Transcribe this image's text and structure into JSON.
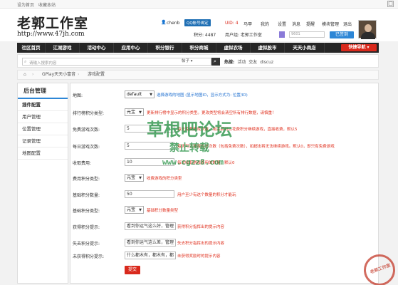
{
  "topbar": {
    "set_home": "设为首页",
    "bookmark": "收藏本站",
    "close_glyph": "□"
  },
  "header": {
    "logo_cn": "老郭工作室",
    "logo_url": "http://www.47jh.com",
    "username": "chenb",
    "qq_bind": "QQ帐号绑定",
    "uid": "UID: 4",
    "menu_links": [
      "马甲",
      "我的",
      "设置",
      "消息",
      "提醒",
      "模块管理",
      "退出"
    ],
    "points": "积分: 4487",
    "user_group": "用户组: 老郭工作室",
    "level_badge": "",
    "signin_input": "9601",
    "signin_button": "已签到"
  },
  "nav": {
    "items": [
      "社区首页",
      "江湖游戏",
      "活动中心",
      "应用中心",
      "积分银行",
      "积分商城",
      "虚拟农场",
      "虚拟股市",
      "天天小商店"
    ],
    "quick_nav": "快捷导航"
  },
  "search": {
    "placeholder": "请输入搜索内容",
    "type": "帖子",
    "hot_label": "热搜:",
    "hot_terms": [
      "活动",
      "交友",
      "discuz"
    ]
  },
  "breadcrumb": {
    "home_icon": "⌂",
    "sep": "›",
    "items": [
      "GPlay天天小富音",
      "游戏配置"
    ]
  },
  "sidebar": {
    "title": "后台管理",
    "items": [
      "插件配置",
      "用户管理",
      "位置管理",
      "记录管理",
      "地图配置"
    ]
  },
  "form": {
    "rows": [
      {
        "label": "地图:",
        "type": "select",
        "value": "default",
        "hint": "选择游戏的地图 (显示地图ID，显示方式为: 位置/ID)",
        "hint_color": "blue"
      },
      {
        "label": "排行榜积分类型:",
        "type": "select",
        "value": "元宝",
        "hint": "更新排行榜中显示的积分类型。更改类型将会清空所有排行数据，请慎重！",
        "hint_color": "red"
      },
      {
        "label": "免费游戏次数:",
        "type": "input",
        "value": "5",
        "hint": "每天免费游戏次数，用完后可以花费积分继续游戏，直接收费，默认5",
        "hint_color": "red"
      },
      {
        "label": "每日游戏次数:",
        "type": "input",
        "value": "5",
        "hint": "每天可以游戏的总次数（包括免费次数），如超出将无法继续游戏。默认0，即只有免费游戏",
        "hint_color": "red"
      },
      {
        "label": "收取费用:",
        "type": "input",
        "value": "10",
        "hint": "每次收取游戏费用的数量，默认0",
        "hint_color": "red"
      },
      {
        "label": "费用积分类型:",
        "type": "select",
        "value": "元宝",
        "hint": "收费游戏的积分类型",
        "hint_color": "red"
      },
      {
        "label": "基础积分数量:",
        "type": "input",
        "value": "50",
        "hint": "用户至少有这个数量的积分才能玩",
        "hint_color": "red"
      },
      {
        "label": "基础积分类型:",
        "type": "select",
        "value": "元宝",
        "hint": "基础积分数量类型",
        "hint_color": "red"
      },
      {
        "label": "获得积分提示:",
        "type": "input",
        "value": "看到你运气这么好，管理",
        "hint": "获得积分指挥出的提示内容",
        "hint_color": "red"
      },
      {
        "label": "失去积分提示:",
        "type": "input",
        "value": "看到你运气这么差，管理",
        "hint": "失去积分指挥出的提示内容",
        "hint_color": "red"
      },
      {
        "label": "未获得积分提示:",
        "type": "input",
        "value": "什么都木有，都木有，都",
        "hint": "未获得奖励时的提示内容",
        "hint_color": "red"
      }
    ],
    "submit_label": "提交"
  },
  "watermark": {
    "line1": "草根吧论坛",
    "line2": "禁止转载",
    "line3": "www.cgzz8.com",
    "stamp": "老郭工作室"
  }
}
